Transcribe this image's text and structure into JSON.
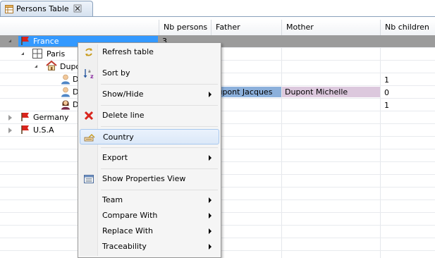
{
  "tab": {
    "title": "Persons Table"
  },
  "columns": {
    "nb_persons": "Nb persons",
    "father": "Father",
    "mother": "Mother",
    "nb_children": "Nb children"
  },
  "tree": {
    "france": {
      "label": "France",
      "nb_persons": "3"
    },
    "paris": {
      "label": "Paris"
    },
    "dupont": {
      "label": "Dupo"
    },
    "person1": {
      "label": "D",
      "nb_children": "1"
    },
    "person2": {
      "label": "D",
      "father": "Dupont Jacques",
      "mother": "Dupont Michelle",
      "nb_children": "0"
    },
    "person3": {
      "label": "D",
      "nb_children": "1"
    },
    "germany": {
      "label": "Germany"
    },
    "usa": {
      "label": "U.S.A"
    }
  },
  "context_menu": {
    "refresh_table": "Refresh table",
    "sort_by": "Sort by",
    "show_hide": "Show/Hide",
    "delete_line": "Delete line",
    "country": "Country",
    "export": "Export",
    "show_properties_view": "Show Properties View",
    "team": "Team",
    "compare_with": "Compare With",
    "replace_with": "Replace With",
    "traceability": "Traceability"
  },
  "colors": {
    "selected_row": "#9b9b9b",
    "selected_tree_cell": "#3399ff",
    "father_cell": "#8cb0db",
    "mother_cell": "#dcc8dd",
    "menu_hover": "#dbe8f8"
  }
}
